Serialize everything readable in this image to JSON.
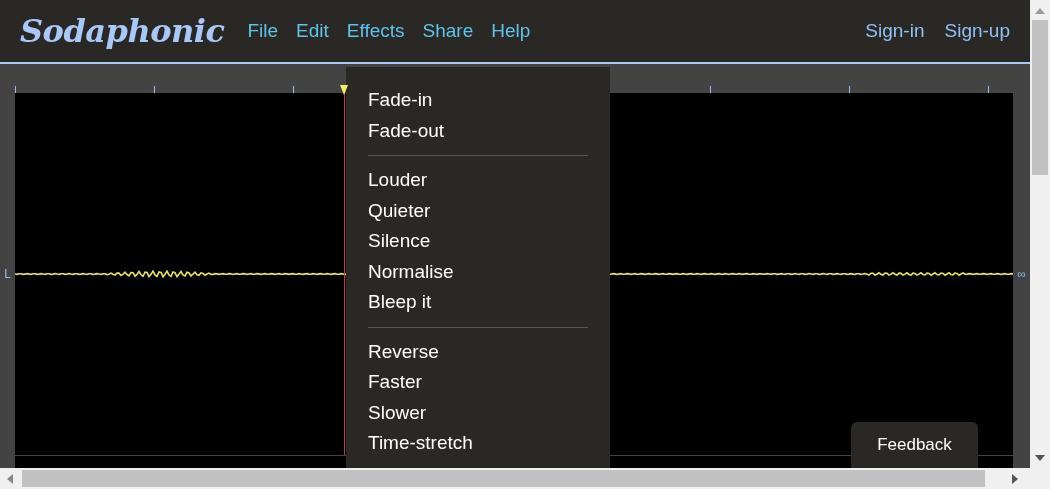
{
  "app": {
    "logo": "Sodaphonic"
  },
  "menu_bar": [
    "File",
    "Edit",
    "Effects",
    "Share",
    "Help"
  ],
  "account_links": [
    "Sign-in",
    "Sign-up"
  ],
  "effects_menu": {
    "groups": [
      [
        "Fade-in",
        "Fade-out"
      ],
      [
        "Louder",
        "Quieter",
        "Silence",
        "Normalise",
        "Bleep it"
      ],
      [
        "Reverse",
        "Faster",
        "Slower",
        "Time-stretch"
      ]
    ]
  },
  "track": {
    "channel_label": "L",
    "right_label": "∞"
  },
  "feedback_button": "Feedback"
}
